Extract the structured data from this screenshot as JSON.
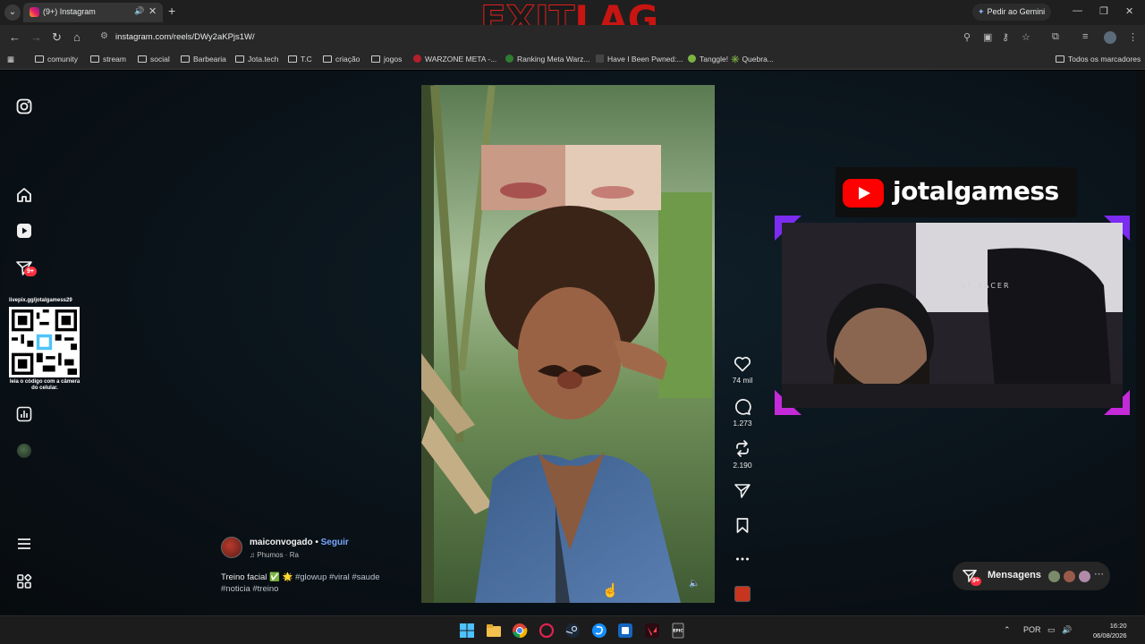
{
  "browser": {
    "tab_title": "(9+) Instagram",
    "url": "instagram.com/reels/DWy2aKPjs1W/",
    "gemini_label": "Pedir ao Gemini",
    "bookmarks": [
      "comunity",
      "stream",
      "social",
      "Barbearia",
      "Jota.tech",
      "T.C",
      "criação",
      "jogos",
      "WARZONE META -...",
      "Ranking Meta Warz...",
      "Have I Been Pwned:...",
      "Tanggle! ✳️ Quebra..."
    ],
    "all_bookmarks": "Todos os marcadores"
  },
  "overlay": {
    "logo_left": "EXIT",
    "logo_right": "LAG",
    "youtube_channel": "jotalgamess",
    "qr_top": "livepix.gg/jotalgamess29",
    "qr_bottom": "leia o código com a câmera do celular.",
    "chair_brand": "XT RACER"
  },
  "sidebar": {
    "notifications_badge": "9+"
  },
  "reel": {
    "username": "maiconvogado",
    "follow": "Seguir",
    "audio": "Phumos · Ra",
    "caption_text": "Treino facial ✅ 🌟",
    "caption_tags_1": "#glowup #viral #saude",
    "caption_tags_2": "#noticia #treino",
    "likes": "74 mil",
    "comments": "1.273",
    "reposts": "2.190"
  },
  "messages": {
    "label": "Mensagens",
    "badge": "9+"
  },
  "taskbar": {
    "language": "POR",
    "time": "16:20",
    "date": "06/08/2026"
  },
  "colors": {
    "instagram_badge": "#ff3040",
    "follow_link": "#7aa7ff",
    "youtube_red": "#ff0000"
  }
}
